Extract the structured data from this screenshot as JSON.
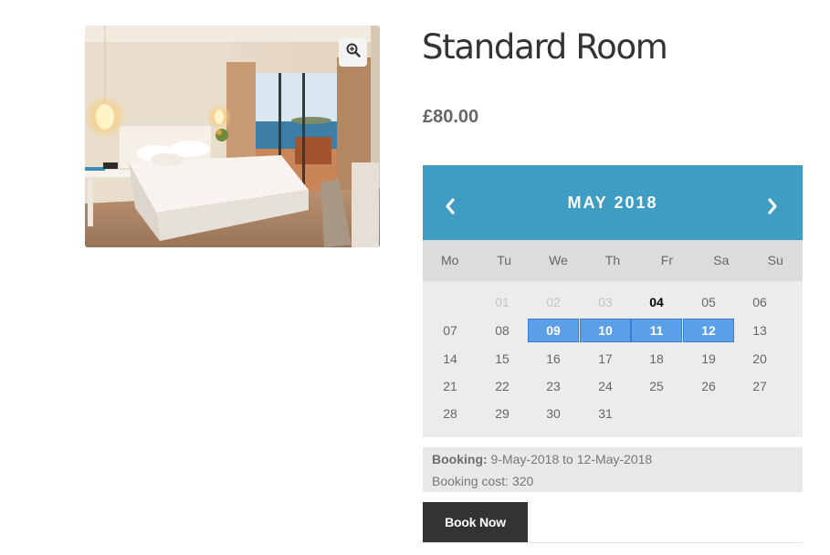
{
  "product": {
    "title": "Standard Room",
    "price": "£80.00"
  },
  "calendar": {
    "month_label": "MAY 2018",
    "prev_icon": "chevron-left-icon",
    "next_icon": "chevron-right-icon",
    "header_color": "#3f9cc3",
    "selected_color": "#5c9fe9",
    "weekdays": [
      "Mo",
      "Tu",
      "We",
      "Th",
      "Fr",
      "Sa",
      "Su"
    ],
    "weeks": [
      [
        {
          "label": ""
        },
        {
          "label": "01",
          "state": "unavailable"
        },
        {
          "label": "02",
          "state": "unavailable"
        },
        {
          "label": "03",
          "state": "unavailable"
        },
        {
          "label": "04",
          "state": "today"
        },
        {
          "label": "05",
          "state": "available"
        },
        {
          "label": "06",
          "state": "available"
        }
      ],
      [
        {
          "label": "07",
          "state": "available"
        },
        {
          "label": "08",
          "state": "available"
        },
        {
          "label": "09",
          "state": "selected"
        },
        {
          "label": "10",
          "state": "selected"
        },
        {
          "label": "11",
          "state": "selected"
        },
        {
          "label": "12",
          "state": "selected"
        },
        {
          "label": "13",
          "state": "available"
        }
      ],
      [
        {
          "label": "14",
          "state": "available"
        },
        {
          "label": "15",
          "state": "available"
        },
        {
          "label": "16",
          "state": "available"
        },
        {
          "label": "17",
          "state": "available"
        },
        {
          "label": "18",
          "state": "available"
        },
        {
          "label": "19",
          "state": "available"
        },
        {
          "label": "20",
          "state": "available"
        }
      ],
      [
        {
          "label": "21",
          "state": "available"
        },
        {
          "label": "22",
          "state": "available"
        },
        {
          "label": "23",
          "state": "available"
        },
        {
          "label": "24",
          "state": "available"
        },
        {
          "label": "25",
          "state": "available"
        },
        {
          "label": "26",
          "state": "available"
        },
        {
          "label": "27",
          "state": "available"
        }
      ],
      [
        {
          "label": "28",
          "state": "available"
        },
        {
          "label": "29",
          "state": "available"
        },
        {
          "label": "30",
          "state": "available"
        },
        {
          "label": "31",
          "state": "available"
        },
        {
          "label": ""
        },
        {
          "label": ""
        },
        {
          "label": ""
        }
      ]
    ]
  },
  "booking": {
    "label": "Booking:",
    "range": " 9-May-2018 to 12-May-2018",
    "cost_text": "Booking cost: 320"
  },
  "actions": {
    "book_now_label": "Book Now",
    "zoom_icon": "zoom-in-icon"
  }
}
